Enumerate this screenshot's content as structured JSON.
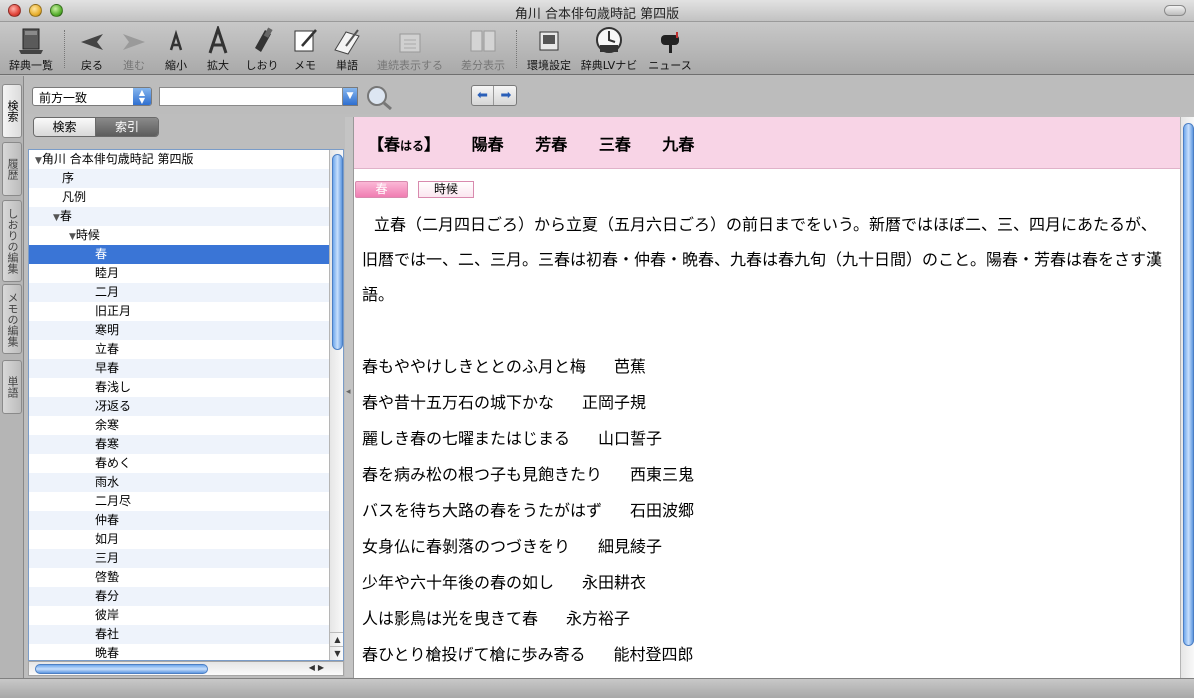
{
  "window": {
    "title": "角川 合本俳句歳時記 第四版"
  },
  "toolbar": {
    "items": [
      {
        "label": "辞典一覧",
        "icon": "books-icon",
        "enabled": true
      },
      {
        "label": "戻る",
        "icon": "back-arrow-icon",
        "enabled": true
      },
      {
        "label": "進む",
        "icon": "forward-arrow-icon",
        "enabled": false
      },
      {
        "label": "縮小",
        "icon": "font-smaller-icon",
        "enabled": true
      },
      {
        "label": "拡大",
        "icon": "font-larger-icon",
        "enabled": true
      },
      {
        "label": "しおり",
        "icon": "bookmark-icon",
        "enabled": true
      },
      {
        "label": "メモ",
        "icon": "memo-icon",
        "enabled": true
      },
      {
        "label": "単語",
        "icon": "word-icon",
        "enabled": true
      },
      {
        "label": "連続表示する",
        "icon": "continuous-icon",
        "enabled": false
      },
      {
        "label": "差分表示",
        "icon": "diff-icon",
        "enabled": false
      },
      {
        "label": "環境設定",
        "icon": "preferences-icon",
        "enabled": true
      },
      {
        "label": "辞典LVナビ",
        "icon": "lv-navi-icon",
        "enabled": true
      },
      {
        "label": "ニュース",
        "icon": "mailbox-icon",
        "enabled": true
      }
    ]
  },
  "side_tabs": [
    "検索",
    "履歴",
    "しおりの編集",
    "メモの編集",
    "単語"
  ],
  "search": {
    "mode": "前方一致",
    "query": ""
  },
  "segment": {
    "left": "検索",
    "right": "索引"
  },
  "tree": {
    "root": "角川 合本俳句歳時記 第四版",
    "rows": [
      "序",
      "凡例",
      "春",
      "時候",
      "春",
      "睦月",
      "二月",
      "旧正月",
      "寒明",
      "立春",
      "早春",
      "春浅し",
      "冴返る",
      "余寒",
      "春寒",
      "春めく",
      "雨水",
      "二月尽",
      "仲春",
      "如月",
      "三月",
      "啓蟄",
      "春分",
      "彼岸",
      "春社",
      "晩春"
    ]
  },
  "entry": {
    "headword": "【春",
    "reading": "はる",
    "close_bracket": "】",
    "variants": [
      "陽春",
      "芳春",
      "三春",
      "九春"
    ],
    "season_tag": "春",
    "category_tag": "時候",
    "definition": "立春（二月四日ごろ）から立夏（五月六日ごろ）の前日までをいう。新暦ではほぼ二、三、四月にあたるが、旧暦では一、二、三月。三春は初春・仲春・晩春、九春は春九旬（九十日間）のこと。陽春・芳春は春をさす漢語。",
    "haiku": [
      {
        "text": "春もややけしきととのふ月と梅",
        "author": "芭蕉"
      },
      {
        "text": "春や昔十五万石の城下かな",
        "author": "正岡子規"
      },
      {
        "text": "麗しき春の七曜またはじまる",
        "author": "山口誓子"
      },
      {
        "text": "春を病み松の根つ子も見飽きたり",
        "author": "西東三鬼"
      },
      {
        "text": "バスを待ち大路の春をうたがはず",
        "author": "石田波郷"
      },
      {
        "text": "女身仏に春剝落のつづきをり",
        "author": "細見綾子"
      },
      {
        "text": "少年や六十年後の春の如し",
        "author": "永田耕衣"
      },
      {
        "text": "人は影鳥は光を曳きて春",
        "author": "永方裕子"
      },
      {
        "text": "春ひとり槍投げて槍に歩み寄る",
        "author": "能村登四郎"
      }
    ]
  },
  "colors": {
    "heading_band": "#f8d4e6",
    "selection": "#3a75d6",
    "season_tag": "#f07db2"
  }
}
